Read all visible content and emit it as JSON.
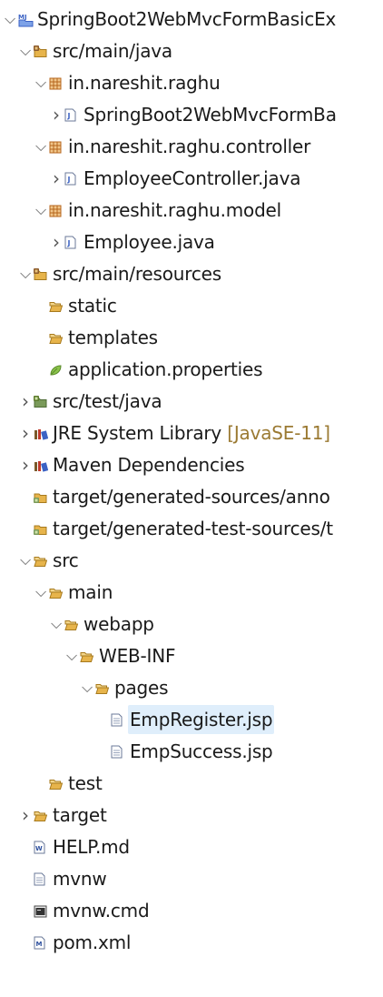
{
  "tree": [
    {
      "label": "SpringBoot2WebMvcFormBasicEx",
      "icon": "project-icon",
      "state": "expanded",
      "depth": 0
    },
    {
      "label": "src/main/java",
      "icon": "source-folder-icon",
      "state": "expanded",
      "depth": 1
    },
    {
      "label": "in.nareshit.raghu",
      "icon": "package-icon",
      "state": "expanded",
      "depth": 2
    },
    {
      "label": "SpringBoot2WebMvcFormBa",
      "icon": "java-file-icon",
      "state": "collapsed",
      "depth": 3
    },
    {
      "label": "in.nareshit.raghu.controller",
      "icon": "package-icon",
      "state": "expanded",
      "depth": 2
    },
    {
      "label": "EmployeeController.java",
      "icon": "java-file-icon",
      "state": "collapsed",
      "depth": 3
    },
    {
      "label": "in.nareshit.raghu.model",
      "icon": "package-icon",
      "state": "expanded",
      "depth": 2
    },
    {
      "label": "Employee.java",
      "icon": "java-file-icon",
      "state": "collapsed",
      "depth": 3
    },
    {
      "label": "src/main/resources",
      "icon": "source-folder-icon",
      "state": "expanded",
      "depth": 1
    },
    {
      "label": "static",
      "icon": "folder-icon",
      "state": "none",
      "depth": 2
    },
    {
      "label": "templates",
      "icon": "folder-icon",
      "state": "none",
      "depth": 2
    },
    {
      "label": "application.properties",
      "icon": "properties-icon",
      "state": "none",
      "depth": 2
    },
    {
      "label": "src/test/java",
      "icon": "test-source-folder-icon",
      "state": "collapsed",
      "depth": 1
    },
    {
      "label": "JRE System Library",
      "decoration": "[JavaSE-11]",
      "icon": "library-icon",
      "state": "collapsed",
      "depth": 1
    },
    {
      "label": "Maven Dependencies",
      "icon": "library-icon",
      "state": "collapsed",
      "depth": 1
    },
    {
      "label": "target/generated-sources/anno",
      "icon": "generated-folder-icon",
      "state": "none",
      "depth": 1
    },
    {
      "label": "target/generated-test-sources/t",
      "icon": "generated-folder-icon",
      "state": "none",
      "depth": 1
    },
    {
      "label": "src",
      "icon": "folder-open-icon",
      "state": "expanded",
      "depth": 1
    },
    {
      "label": "main",
      "icon": "folder-open-icon",
      "state": "expanded",
      "depth": 2
    },
    {
      "label": "webapp",
      "icon": "folder-open-icon",
      "state": "expanded",
      "depth": 3
    },
    {
      "label": "WEB-INF",
      "icon": "folder-open-icon",
      "state": "expanded",
      "depth": 4
    },
    {
      "label": "pages",
      "icon": "folder-open-icon",
      "state": "expanded",
      "depth": 5
    },
    {
      "label": "EmpRegister.jsp",
      "icon": "jsp-file-icon",
      "state": "none",
      "depth": 6,
      "selected": true
    },
    {
      "label": "EmpSuccess.jsp",
      "icon": "jsp-file-icon",
      "state": "none",
      "depth": 6
    },
    {
      "label": "test",
      "icon": "folder-icon",
      "state": "none",
      "depth": 2
    },
    {
      "label": "target",
      "icon": "folder-icon",
      "state": "collapsed",
      "depth": 1
    },
    {
      "label": "HELP.md",
      "icon": "markdown-file-icon",
      "state": "none",
      "depth": 1
    },
    {
      "label": "mvnw",
      "icon": "text-file-icon",
      "state": "none",
      "depth": 1
    },
    {
      "label": "mvnw.cmd",
      "icon": "cmd-file-icon",
      "state": "none",
      "depth": 1
    },
    {
      "label": "pom.xml",
      "icon": "maven-pom-icon",
      "state": "none",
      "depth": 1
    }
  ],
  "colors": {
    "folder": "#e7b44b",
    "package": "#b5651d",
    "selection": "#dfeefb",
    "decoration": "#9b7a33"
  }
}
